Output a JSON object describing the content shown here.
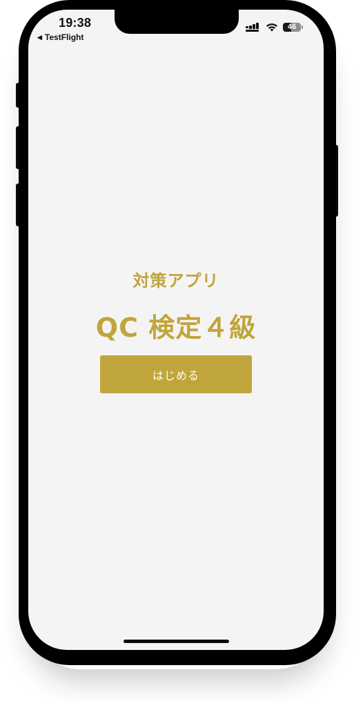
{
  "status_bar": {
    "time": "19:38",
    "back_app": "TestFlight",
    "battery_level": "46",
    "battery_fraction": 0.46
  },
  "main": {
    "subtitle": "対策アプリ",
    "title": "QC 検定４級",
    "start_button_label": "はじめる"
  },
  "colors": {
    "accent": "#c0a53a",
    "background": "#f4f4f4",
    "button_text": "#ffffff"
  },
  "icons": [
    "back-arrow-icon",
    "cellular-signal-icon",
    "wifi-icon",
    "battery-icon"
  ]
}
